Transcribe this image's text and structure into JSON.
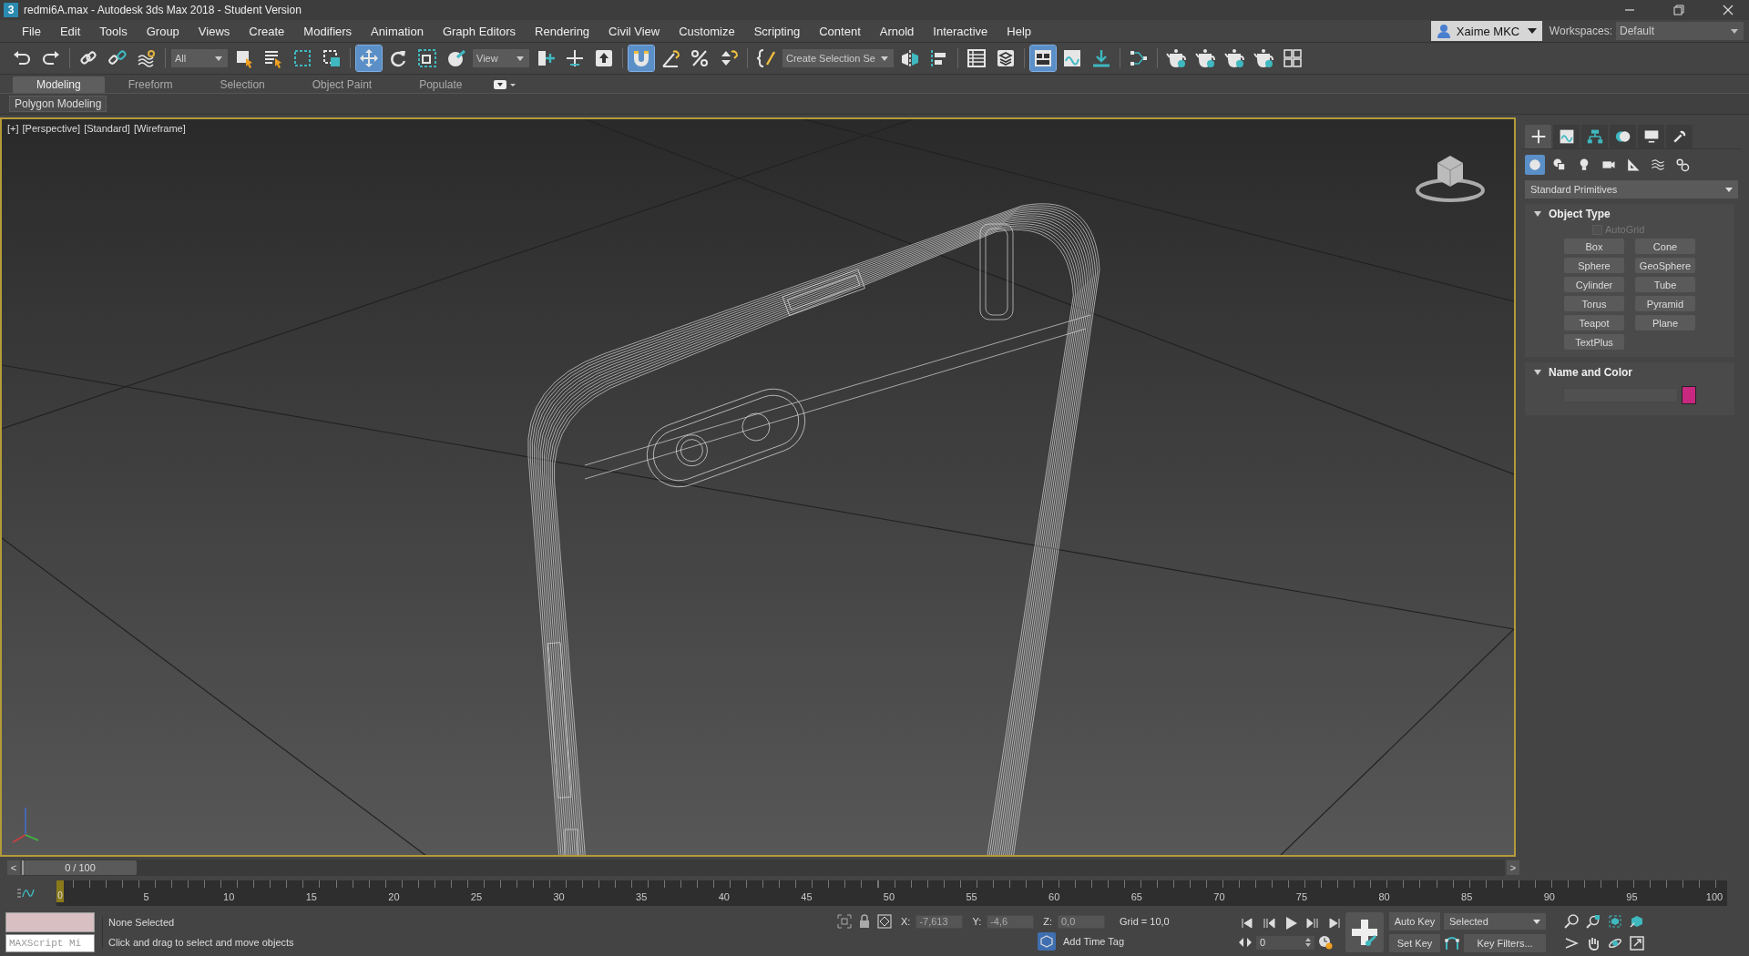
{
  "title_bar": {
    "title": "redmi6A.max - Autodesk 3ds Max 2018 - Student Version",
    "app_icon": "3"
  },
  "menu": [
    "File",
    "Edit",
    "Tools",
    "Group",
    "Views",
    "Create",
    "Modifiers",
    "Animation",
    "Graph Editors",
    "Rendering",
    "Civil View",
    "Customize",
    "Scripting",
    "Content",
    "Arnold",
    "Interactive",
    "Help"
  ],
  "user": {
    "name": "Xaime MKC"
  },
  "workspaces": {
    "label": "Workspaces:",
    "value": "Default"
  },
  "toolbar": [
    {
      "kind": "undo",
      "selected": false
    },
    {
      "kind": "redo",
      "selected": false
    },
    {
      "kind": "sep"
    },
    {
      "kind": "link",
      "selected": false
    },
    {
      "kind": "unlink",
      "selected": false
    },
    {
      "kind": "wave",
      "selected": false
    },
    {
      "kind": "sep"
    },
    {
      "kind": "dropdown",
      "value": "All"
    },
    {
      "kind": "select",
      "selected": false
    },
    {
      "kind": "list",
      "selected": false
    },
    {
      "kind": "region",
      "selected": false
    },
    {
      "kind": "crossing",
      "selected": false
    },
    {
      "kind": "sep"
    },
    {
      "kind": "move",
      "selected": true
    },
    {
      "kind": "rotate",
      "selected": false
    },
    {
      "kind": "scale",
      "selected": false
    },
    {
      "kind": "placement",
      "selected": false
    },
    {
      "kind": "dropdown",
      "value": "View"
    },
    {
      "kind": "pivot",
      "selected": false
    },
    {
      "kind": "cross",
      "selected": false
    },
    {
      "kind": "push",
      "selected": false
    },
    {
      "kind": "sep"
    },
    {
      "kind": "snap",
      "selected": true
    },
    {
      "kind": "angle",
      "selected": false
    },
    {
      "kind": "percent",
      "selected": false
    },
    {
      "kind": "spinner",
      "selected": false
    },
    {
      "kind": "sep"
    },
    {
      "kind": "braces",
      "selected": false
    },
    {
      "kind": "dropdown",
      "value": "Create Selection Se"
    },
    {
      "kind": "mirror",
      "selected": false
    },
    {
      "kind": "align",
      "selected": false
    },
    {
      "kind": "sep"
    },
    {
      "kind": "table",
      "selected": false
    },
    {
      "kind": "layers",
      "selected": false
    },
    {
      "kind": "sep"
    },
    {
      "kind": "panel",
      "selected": true
    },
    {
      "kind": "curve",
      "selected": false
    },
    {
      "kind": "download",
      "selected": false
    },
    {
      "kind": "sep"
    },
    {
      "kind": "schematic",
      "selected": false
    },
    {
      "kind": "sep"
    },
    {
      "kind": "teapot",
      "selected": false
    },
    {
      "kind": "teapot",
      "selected": false
    },
    {
      "kind": "teapot",
      "selected": false
    },
    {
      "kind": "teapot",
      "selected": false
    },
    {
      "kind": "grid4",
      "selected": false
    }
  ],
  "ribbon_tabs": [
    {
      "label": "Modeling",
      "selected": true
    },
    {
      "label": "Freeform",
      "selected": false
    },
    {
      "label": "Selection",
      "selected": false
    },
    {
      "label": "Object Paint",
      "selected": false
    },
    {
      "label": "Populate",
      "selected": false
    }
  ],
  "ribbon_panel": {
    "label": "Polygon Modeling"
  },
  "viewport": {
    "labels": [
      "[+]",
      "[Perspective]",
      "[Standard]",
      "[Wireframe]"
    ]
  },
  "command_panel": {
    "tabs": [
      {
        "kind": "plus",
        "selected": true
      },
      {
        "kind": "curve",
        "selected": false
      },
      {
        "kind": "hierarchy",
        "selected": false
      },
      {
        "kind": "circles",
        "selected": false
      },
      {
        "kind": "monitor",
        "selected": false
      },
      {
        "kind": "wrench",
        "selected": false
      }
    ],
    "categories": [
      {
        "kind": "sphere",
        "selected": true
      },
      {
        "kind": "shapes",
        "selected": false
      },
      {
        "kind": "bulb",
        "selected": false
      },
      {
        "kind": "camera",
        "selected": false
      },
      {
        "kind": "ruler",
        "selected": false
      },
      {
        "kind": "waves",
        "selected": false
      },
      {
        "kind": "gears",
        "selected": false
      }
    ],
    "dropdown": "Standard Primitives",
    "object_type": {
      "title": "Object Type",
      "autogrid": {
        "label": "AutoGrid",
        "checked": false,
        "disabled": true
      },
      "buttons": [
        "Box",
        "Cone",
        "Sphere",
        "GeoSphere",
        "Cylinder",
        "Tube",
        "Torus",
        "Pyramid",
        "Teapot",
        "Plane",
        "TextPlus"
      ]
    },
    "name_and_color": {
      "title": "Name and Color",
      "color": "#c8287f"
    }
  },
  "timeline": {
    "prev": "<",
    "position": "0 / 100",
    "level": 0,
    "next": ">",
    "marker": "0",
    "ticks": [
      "5",
      "10",
      "15",
      "20",
      "25",
      "30",
      "35",
      "40",
      "45",
      "50",
      "55",
      "60",
      "65",
      "70",
      "75",
      "80",
      "85",
      "90",
      "95",
      "100"
    ]
  },
  "status": {
    "maxscript": "MAXScript Mi",
    "selection": "None Selected",
    "prompt": "Click and drag to select and move objects",
    "coords": [
      {
        "label": "X:",
        "value": "-7,613"
      },
      {
        "label": "Y:",
        "value": "-4,6"
      },
      {
        "label": "Z:",
        "value": "0,0"
      }
    ],
    "grid": "Grid = 10,0",
    "time_tag": "Add Time Tag",
    "frame": "0",
    "auto_key": "Auto Key",
    "set_key": "Set Key",
    "key_mode": "Selected",
    "key_filters": "Key Filters..."
  }
}
